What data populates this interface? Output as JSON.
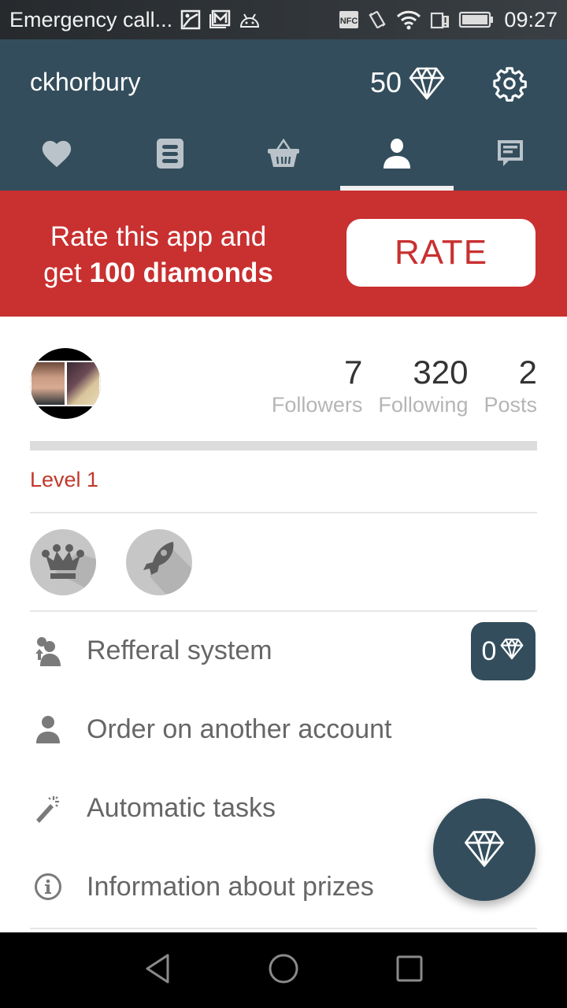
{
  "status_bar": {
    "carrier_text": "Emergency call...",
    "notification_icons": [
      "gallery-icon",
      "gmail-icon",
      "android-icon"
    ],
    "system_icons": [
      "nfc-icon",
      "vibrate-icon",
      "wifi-icon",
      "sim-alert-icon",
      "battery-icon"
    ],
    "time": "09:27"
  },
  "header": {
    "username": "ckhorbury",
    "diamonds": "50",
    "diamond_icon": "diamond-icon",
    "settings_icon": "gear-icon"
  },
  "tabs": [
    {
      "name": "likes",
      "icon": "heart-icon",
      "active": false
    },
    {
      "name": "orders",
      "icon": "list-icon",
      "active": false
    },
    {
      "name": "shop",
      "icon": "basket-icon",
      "active": false
    },
    {
      "name": "profile",
      "icon": "person-icon",
      "active": true
    },
    {
      "name": "messages",
      "icon": "chat-icon",
      "active": false
    }
  ],
  "rate_banner": {
    "line1": "Rate this app and",
    "line2_prefix": "get ",
    "line2_bold": "100 diamonds",
    "button_label": "RATE"
  },
  "profile": {
    "stats": [
      {
        "value": "7",
        "label": "Followers"
      },
      {
        "value": "320",
        "label": "Following"
      },
      {
        "value": "2",
        "label": "Posts"
      }
    ],
    "level_progress": 0,
    "level_label": "Level 1",
    "badges": [
      {
        "name": "crown",
        "icon": "crown-icon"
      },
      {
        "name": "rocket",
        "icon": "rocket-icon"
      }
    ]
  },
  "menu": [
    {
      "label": "Refferal system",
      "icon": "referral-icon",
      "badge_value": "0"
    },
    {
      "label": "Order on another account",
      "icon": "person-icon"
    },
    {
      "label": "Automatic tasks",
      "icon": "magic-wand-icon"
    },
    {
      "label": "Information about prizes",
      "icon": "info-icon"
    }
  ],
  "colors": {
    "primary": "#334d5c",
    "accent": "#c93030",
    "level_text": "#c0392b"
  },
  "nav_bar": [
    "back-icon",
    "home-icon",
    "recents-icon"
  ]
}
